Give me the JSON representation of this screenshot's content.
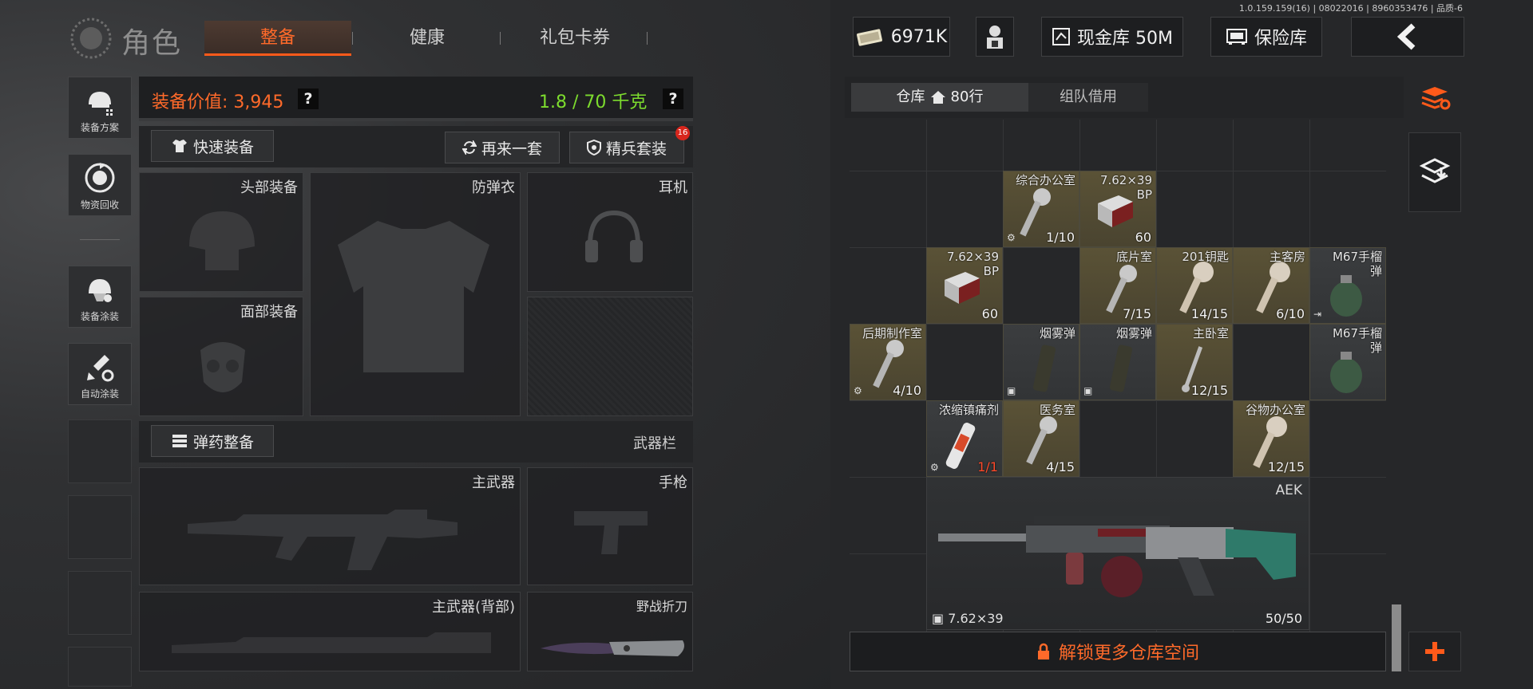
{
  "version": "1.0.159.159(16) | 08022016 | 8960353476 | 品质-6",
  "header": {
    "title": "角色",
    "tabs": [
      {
        "label": "整备",
        "active": true
      },
      {
        "label": "健康",
        "active": false
      },
      {
        "label": "礼包卡券",
        "active": false
      }
    ],
    "cash": "6971K",
    "vault_cash": "现金库 50M",
    "safe": "保险库"
  },
  "rail": {
    "plan": "装备方案",
    "recycle": "物资回收",
    "paint": "装备涂装",
    "auto_paint": "自动涂装"
  },
  "equipment": {
    "value_label": "装备价值: 3,945",
    "weight_label": "1.8 / 70 千克",
    "help": "?",
    "quick_equip": "快速装备",
    "again": "再来一套",
    "elite_set": "精兵套装",
    "elite_badge": "16",
    "slots": {
      "head": "头部装备",
      "armor": "防弹衣",
      "headset": "耳机",
      "face": "面部装备",
      "ammo": "弹药整备",
      "weapon_bar": "武器栏",
      "primary": "主武器",
      "pistol": "手枪",
      "primary_back": "主武器(背部)",
      "knife": "野战折刀"
    }
  },
  "warehouse": {
    "tab_storage": "仓库",
    "tab_rows": "80行",
    "tab_team": "组队借用",
    "unlock": "解锁更多仓库空间",
    "items": [
      {
        "name": "综合办公室",
        "count": "1/10"
      },
      {
        "name": "7.62×39\nBP",
        "count": "60"
      },
      {
        "name": "7.62×39\nBP",
        "count": "60"
      },
      {
        "name": "底片室",
        "count": "7/15"
      },
      {
        "name": "201钥匙",
        "count": "14/15"
      },
      {
        "name": "主客房",
        "count": "6/10"
      },
      {
        "name": "M67手榴\n弹",
        "count": ""
      },
      {
        "name": "后期制作室",
        "count": "4/10"
      },
      {
        "name": "烟雾弹",
        "count": ""
      },
      {
        "name": "烟雾弹",
        "count": ""
      },
      {
        "name": "主卧室",
        "count": "12/15"
      },
      {
        "name": "M67手榴\n弹",
        "count": ""
      },
      {
        "name": "浓缩镇痛剂",
        "count": "1/1"
      },
      {
        "name": "医务室",
        "count": "4/15"
      },
      {
        "name": "谷物办公室",
        "count": "12/15"
      }
    ],
    "weapon": {
      "name": "AEK",
      "ammo_type": "7.62×39",
      "ammo": "50/50"
    }
  },
  "colors": {
    "accent": "#ff6a2a",
    "weight": "#7ddc2e",
    "gold_cell": "#5a5236"
  }
}
